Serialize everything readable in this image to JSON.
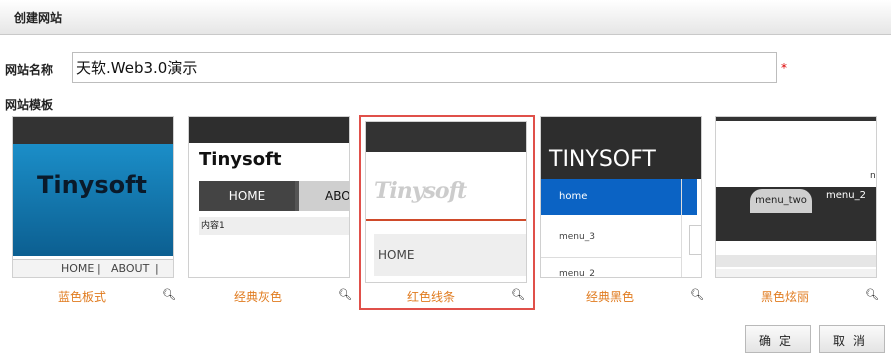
{
  "header": {
    "title": "创建网站"
  },
  "form": {
    "site_name_label": "网站名称",
    "site_name_value": "天软.Web3.0演示",
    "required_mark": "*",
    "template_label": "网站模板"
  },
  "templates": [
    {
      "name": "蓝色板式",
      "selected": false,
      "thumb": {
        "logo": "Tinysoft",
        "nav1": "HOME",
        "nav2": "ABOUT"
      }
    },
    {
      "name": "经典灰色",
      "selected": false,
      "thumb": {
        "logo": "Tinysoft",
        "nav1": "HOME",
        "nav2": "ABO",
        "sub": "内容1"
      }
    },
    {
      "name": "红色线条",
      "selected": true,
      "thumb": {
        "logo": "Tinysoft",
        "nav1": "HOME"
      }
    },
    {
      "name": "经典黑色",
      "selected": false,
      "thumb": {
        "logo": "TINYSOFT",
        "nav1": "home",
        "nav2": "menu_3",
        "nav3": "menu_2"
      }
    },
    {
      "name": "黑色炫丽",
      "selected": false,
      "thumb": {
        "tab1": "menu_two",
        "tab2": "menu_2",
        "letter": "n"
      }
    }
  ],
  "buttons": {
    "confirm": "确定",
    "cancel": "取消"
  },
  "icons": {
    "preview": "magnifier-icon"
  },
  "colors": {
    "template_name": "#e07b1f",
    "selected_border": "#e0504a",
    "required": "#dd0000"
  }
}
